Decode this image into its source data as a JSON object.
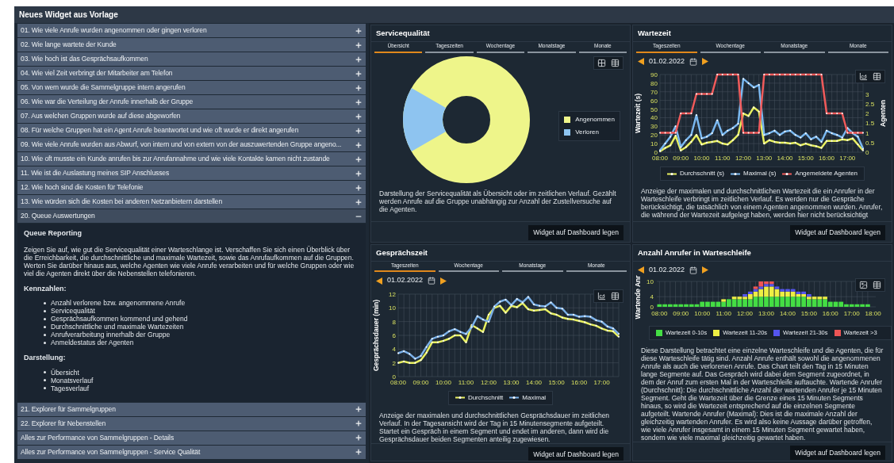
{
  "window": {
    "title": "Neues Widget aus Vorlage"
  },
  "templates": [
    {
      "label": "01. Wie viele Anrufe wurden angenommen oder gingen verloren",
      "expanded": false
    },
    {
      "label": "02. Wie lange wartete der Kunde",
      "expanded": false
    },
    {
      "label": "03. Wie hoch ist das Gesprächsaufkommen",
      "expanded": false
    },
    {
      "label": "04. Wie viel Zeit verbringt der Mitarbeiter am Telefon",
      "expanded": false
    },
    {
      "label": "05. Von wem wurde die Sammelgruppe intern angerufen",
      "expanded": false
    },
    {
      "label": "06. Wie war die Verteilung der Anrufe innerhalb der Gruppe",
      "expanded": false
    },
    {
      "label": "07. Aus welchen Gruppen wurde auf diese abgeworfen",
      "expanded": false
    },
    {
      "label": "08. Für welche Gruppen hat ein Agent Anrufe beantwortet und wie oft wurde er direkt angerufen",
      "expanded": false
    },
    {
      "label": "09. Wie viele Anrufe wurden aus Abwurf, von intern und von extern von der auszuwertenden Gruppe angeno...",
      "expanded": false
    },
    {
      "label": "10. Wie oft musste ein Kunde anrufen bis zur Anrufannahme und wie viele Kontakte kamen nicht zustande",
      "expanded": false
    },
    {
      "label": "11. Wie ist die Auslastung meines SIP Anschlusses",
      "expanded": false
    },
    {
      "label": "12. Wie hoch sind die Kosten für Telefonie",
      "expanded": false
    },
    {
      "label": "13. Wie würden sich die Kosten bei anderen Netzanbietern darstellen",
      "expanded": false
    },
    {
      "label": "20. Queue Auswertungen",
      "expanded": true,
      "details": {
        "heading": "Queue Reporting",
        "text": "Zeigen Sie auf, wie gut die Servicequalität einer Warteschlange ist. Verschaffen Sie sich einen Überblick über die Erreichbarkeit, die durchschnittliche und maximale Wartezeit, sowie das Anrufaufkommen auf die Gruppen. Werten Sie darüber hinaus aus, welche Agenten wie viele Anrufe verarbeiten und für welche Gruppen oder wie viel die Agenten direkt über die Nebenstellen telefonieren.",
        "sections": [
          {
            "heading": "Kennzahlen:",
            "items": [
              "Anzahl verlorene bzw. angenommene Anrufe",
              "Servicequalität",
              "Gesprächsaufkommen kommend und gehend",
              "Durchschnittliche und maximale Wartezeiten",
              "Anrufverarbeitung innerhalb der Gruppe",
              "Anmeldestatus der Agenten"
            ]
          },
          {
            "heading": "Darstellung:",
            "items": [
              "Übersicht",
              "Monatsverlauf",
              "Tagesverlauf"
            ]
          }
        ]
      }
    },
    {
      "label": "21. Explorer für Sammelgruppen",
      "expanded": false
    },
    {
      "label": "22. Explorer für Nebenstellen",
      "expanded": false
    },
    {
      "label": "Alles zur Performance von Sammelgruppen - Details",
      "expanded": false
    },
    {
      "label": "Alles zur Performance von Sammelgruppen - Service Qualität",
      "expanded": false
    }
  ],
  "widgets": [
    {
      "kind": "donut",
      "title": "Servicequalität",
      "tabs": [
        {
          "label": "Übersicht",
          "selected": true
        },
        {
          "label": "Tageszeiten",
          "selected": false
        },
        {
          "label": "Wochentage",
          "selected": false
        },
        {
          "label": "Monatstage",
          "selected": false
        },
        {
          "label": "Monate",
          "selected": false
        }
      ],
      "legend": [
        {
          "label": "Angenommen",
          "color": "#eef58a"
        },
        {
          "label": "Verloren",
          "color": "#8ec4f0"
        }
      ],
      "description": "Darstellung der Servicequalität als Übersicht oder im zeitlichen Verlauf. Gezählt werden Anrufe auf die Gruppe unabhängig zur Anzahl der Zustellversuche auf die Agenten.",
      "button": "Widget auf Dashboard legen"
    },
    {
      "kind": "line",
      "title": "Wartezeit",
      "tabs": [
        {
          "label": "Tageszeiten",
          "selected": true
        },
        {
          "label": "Wochentage",
          "selected": false
        },
        {
          "label": "Monatstage",
          "selected": false
        },
        {
          "label": "Monate",
          "selected": false
        }
      ],
      "date": "01.02.2022",
      "chart_data": {
        "type": "line",
        "grid": true,
        "ylabel": "Wartezeit (s)",
        "y2label": "Agenten",
        "x": [
          8,
          8.25,
          8.5,
          8.75,
          9,
          9.25,
          9.5,
          9.75,
          10,
          10.25,
          10.5,
          10.75,
          11,
          11.25,
          11.5,
          11.75,
          12,
          12.25,
          12.5,
          12.75,
          13,
          13.25,
          13.5,
          13.75,
          14,
          14.25,
          14.5,
          14.75,
          15,
          15.25,
          15.5,
          15.75,
          16,
          16.25,
          16.5,
          16.75,
          17,
          17.25,
          17.5,
          17.75
        ],
        "xlim": [
          8,
          17.75
        ],
        "ylim": [
          0,
          90
        ],
        "yticks": [
          0,
          10,
          20,
          30,
          40,
          50,
          60,
          70,
          80,
          90
        ],
        "y2lim": [
          0,
          4
        ],
        "y2ticks": [
          0,
          0.5,
          1,
          1.5,
          2,
          2.5,
          3
        ],
        "xticks": [
          {
            "value": 8,
            "label": "08:00"
          },
          {
            "value": 9,
            "label": "09:00"
          },
          {
            "value": 10,
            "label": "10:00"
          },
          {
            "value": 11,
            "label": "11:00"
          },
          {
            "value": 12,
            "label": "12:00"
          },
          {
            "value": 13,
            "label": "13:00"
          },
          {
            "value": 14,
            "label": "14:00"
          },
          {
            "value": 15,
            "label": "15:00"
          },
          {
            "value": 16,
            "label": "16:00"
          },
          {
            "value": 17,
            "label": "17:00"
          }
        ],
        "series": [
          {
            "name": "Durchschnitt (s)",
            "color": "#e8f060",
            "values": [
              1,
              5,
              8,
              19,
              2,
              6,
              12,
              20,
              9,
              11,
              12,
              13,
              10,
              9,
              14,
              20,
              45,
              42,
              52,
              47,
              10,
              14,
              12,
              11,
              11,
              10,
              11,
              8,
              10,
              8,
              7,
              5,
              13,
              13,
              13,
              15,
              14,
              16,
              9,
              2
            ]
          },
          {
            "name": "Maximal (s)",
            "color": "#7ab8f0",
            "values": [
              2,
              10,
              18,
              30,
              6,
              14,
              20,
              43,
              16,
              18,
              22,
              37,
              20,
              25,
              28,
              33,
              85,
              80,
              75,
              78,
              20,
              22,
              25,
              20,
              24,
              25,
              20,
              17,
              22,
              15,
              18,
              12,
              25,
              22,
              20,
              17,
              28,
              22,
              18,
              4
            ]
          },
          {
            "name": "Angemeldete Agenten",
            "color": "#f05a5a",
            "axis": "y2",
            "values": [
              1,
              1,
              1,
              1,
              2,
              2,
              2,
              3,
              3,
              3,
              3,
              4,
              4,
              4,
              4,
              4,
              1,
              1,
              1,
              1,
              4,
              4,
              4,
              4,
              4,
              4,
              4,
              4,
              4,
              4,
              4,
              4,
              2,
              2,
              2,
              2,
              1,
              1,
              1,
              1
            ]
          }
        ]
      },
      "description": "Anzeige der maximalen und durchschnittlichen Wartezeit die ein Anrufer in der Warteschleife verbringt im zeitlichen Verlauf. Es werden nur die Gespräche berücksichtigt, die tatsächlich von einem Agenten angenommen wurden. Anrufer, die während der Wartezeit aufgelegt haben, werden hier nicht berücksichtigt",
      "button": "Widget auf Dashboard legen"
    },
    {
      "kind": "line",
      "title": "Gesprächszeit",
      "tabs": [
        {
          "label": "Tageszeiten",
          "selected": true
        },
        {
          "label": "Wochentage",
          "selected": false
        },
        {
          "label": "Monatstage",
          "selected": false
        },
        {
          "label": "Monate",
          "selected": false
        }
      ],
      "date": "01.02.2022",
      "chart_data": {
        "type": "line",
        "grid": true,
        "ylabel": "Gesprächsdauer (min)",
        "x": [
          8,
          8.25,
          8.5,
          8.75,
          9,
          9.25,
          9.5,
          9.75,
          10,
          10.25,
          10.5,
          10.75,
          11,
          11.25,
          11.5,
          11.75,
          12,
          12.25,
          12.5,
          12.75,
          13,
          13.25,
          13.5,
          13.75,
          14,
          14.25,
          14.5,
          14.75,
          15,
          15.25,
          15.5,
          15.75,
          16,
          16.25,
          16.5,
          16.75,
          17,
          17.25,
          17.5,
          17.75
        ],
        "xlim": [
          8,
          17.75
        ],
        "ylim": [
          0,
          12
        ],
        "yticks": [
          0,
          2,
          4,
          6,
          8,
          10,
          12
        ],
        "xticks": [
          {
            "value": 8,
            "label": "08:00"
          },
          {
            "value": 9,
            "label": "09:00"
          },
          {
            "value": 10,
            "label": "10:00"
          },
          {
            "value": 11,
            "label": "11:00"
          },
          {
            "value": 12,
            "label": "12:00"
          },
          {
            "value": 13,
            "label": "13:00"
          },
          {
            "value": 14,
            "label": "14:00"
          },
          {
            "value": 15,
            "label": "15:00"
          },
          {
            "value": 16,
            "label": "16:00"
          },
          {
            "value": 17,
            "label": "17:00"
          }
        ],
        "series": [
          {
            "name": "Durchschnitt",
            "color": "#e8f060",
            "values": [
              2,
              2.2,
              2,
              2,
              2.4,
              3.5,
              5,
              5,
              5.2,
              5.5,
              6,
              6,
              5,
              7.5,
              7,
              6.5,
              9,
              10,
              10.3,
              9.3,
              10.3,
              10.1,
              10.7,
              9.8,
              9.6,
              9.7,
              9.8,
              9.2,
              9,
              8.6,
              8.4,
              8.3,
              8.1,
              7.9,
              7.6,
              7.4,
              7,
              6.7,
              6.6,
              5.8
            ]
          },
          {
            "name": "Maximal",
            "color": "#7ab0e8",
            "values": [
              3.4,
              3.7,
              3.3,
              2.6,
              3,
              4.3,
              5.5,
              5.8,
              6,
              6.6,
              6.9,
              6.5,
              6.2,
              7.2,
              8.8,
              8.3,
              8,
              10.2,
              10.9,
              11.2,
              10.4,
              11.3,
              10.8,
              11.6,
              10.5,
              10.3,
              10.2,
              10.8,
              10,
              9.9,
              9,
              9,
              8.7,
              8.8,
              8.7,
              8.2,
              8,
              7.3,
              7,
              6.2
            ]
          }
        ]
      },
      "description": "Anzeige der maximalen und durchschnittlichen Gesprächsdauer im zeitlichen Verlauf. In der Tagesansicht wird der Tag in 15 Minutensegmente aufgeteilt. Startet ein Gespräch in einem Segment und endet im anderen, dann wird die Gesprächsdauer beiden Segmenten anteilig zugewiesen.",
      "button": "Widget auf Dashboard legen"
    },
    {
      "kind": "bar",
      "title": "Anzahl Anrufer in Warteschleife",
      "date": "01.02.2022",
      "chart_data": {
        "type": "bar",
        "stacked": true,
        "grid": true,
        "ylabel": "Wartende Anr",
        "x": [
          8,
          8.25,
          8.5,
          8.75,
          9,
          9.25,
          9.5,
          9.75,
          10,
          10.25,
          10.5,
          10.75,
          11,
          11.25,
          11.5,
          11.75,
          12,
          12.25,
          12.5,
          12.75,
          13,
          13.25,
          13.5,
          13.75,
          14,
          14.25,
          14.5,
          14.75,
          15,
          15.25,
          15.5,
          15.75,
          16,
          16.25,
          16.5,
          16.75,
          17,
          17.25,
          17.5,
          17.75
        ],
        "xlim": [
          7.875,
          18.125
        ],
        "ylim": [
          0,
          10
        ],
        "yticks": [
          0,
          4,
          10
        ],
        "xticks": [
          {
            "value": 8,
            "label": "08:00"
          },
          {
            "value": 9,
            "label": "09:00"
          },
          {
            "value": 10,
            "label": "10:00"
          },
          {
            "value": 11,
            "label": "11:00"
          },
          {
            "value": 12,
            "label": "12:00"
          },
          {
            "value": 13,
            "label": "13:00"
          },
          {
            "value": 14,
            "label": "14:00"
          },
          {
            "value": 15,
            "label": "15:00"
          },
          {
            "value": 16,
            "label": "16:00"
          },
          {
            "value": 17,
            "label": "17:00"
          },
          {
            "value": 18,
            "label": "18:00"
          }
        ],
        "series": [
          {
            "name": "Wartezeit 0-10s",
            "color": "#44dd44",
            "values": [
              1,
              1,
              1,
              1,
              1,
              1,
              1,
              1,
              2,
              2,
              2,
              2,
              2,
              3,
              3,
              3,
              3,
              3,
              4,
              4,
              4,
              4,
              4,
              4,
              4,
              4,
              4,
              4,
              3,
              3,
              3,
              3,
              2,
              2,
              2,
              1,
              1,
              1,
              1,
              1
            ]
          },
          {
            "name": "Wartezeit 11-20s",
            "color": "#eeee44",
            "values": [
              0,
              0,
              0,
              0,
              0,
              0,
              0,
              0,
              0,
              0,
              0,
              0,
              1,
              0,
              1,
              1,
              1,
              2,
              2,
              3,
              4,
              4,
              3,
              2,
              2,
              2,
              1,
              1,
              1,
              1,
              1,
              1,
              0,
              0,
              0,
              0,
              0,
              0,
              0,
              0
            ]
          },
          {
            "name": "Wartezeit 21-30s",
            "color": "#5555ee",
            "values": [
              0,
              0,
              0,
              0,
              0,
              0,
              0,
              0,
              0,
              0,
              0,
              0,
              0,
              0,
              0,
              0,
              1,
              1,
              1,
              1,
              1,
              1,
              1,
              1,
              1,
              1,
              1,
              1,
              1,
              0,
              0,
              0,
              0,
              0,
              0,
              0,
              0,
              0,
              0,
              0
            ]
          },
          {
            "name": "Wartezeit >3",
            "color": "#ee5555",
            "values": [
              0,
              0,
              0,
              0,
              0,
              0,
              0,
              0,
              0,
              0,
              0,
              0,
              0,
              0,
              0,
              0,
              0,
              0,
              1,
              2,
              1,
              1,
              0,
              0,
              0,
              0,
              0,
              0,
              0,
              0,
              0,
              0,
              0,
              0,
              0,
              0,
              0,
              0,
              0,
              0
            ]
          }
        ]
      },
      "description": "Diese Darstellung betrachtet eine einzelne Warteschleife und die Agenten, die für diese Warteschleife tätig sind. Anzahl Anrufe enthält sowohl die angenommenen Anrufe als auch die verlorenen Anrufe. Das Chart teilt den Tag in 15 Minuten lange Segmente auf. Das Gespräch wird dabei dem Segment zugeordnet, in dem der Anruf zum ersten Mal in der Warteschleife auftauchte. Wartende Anrufer (Durchschnitt): Die durchschnittliche Anzahl der wartenden Anrufer je 15 Minuten Segment. Geht die Wartezeit über die Grenze eines 15 Minuten Segments hinaus, so wird die Wartezeit entsprechend auf die einzelnen Segmente aufgeteilt. Wartende Anrufer (Maximal): Dies ist die maximale Anzahl der gleichzeitig wartenden Anrufer. Es wird also keine Aussage darüber getroffen, wie viele Anrufer insgesamt in einem 15 Minuten Segment gewartet haben, sondern wie viele maximal gleichzeitig gewartet haben.",
      "button": "Widget auf Dashboard legen"
    }
  ]
}
